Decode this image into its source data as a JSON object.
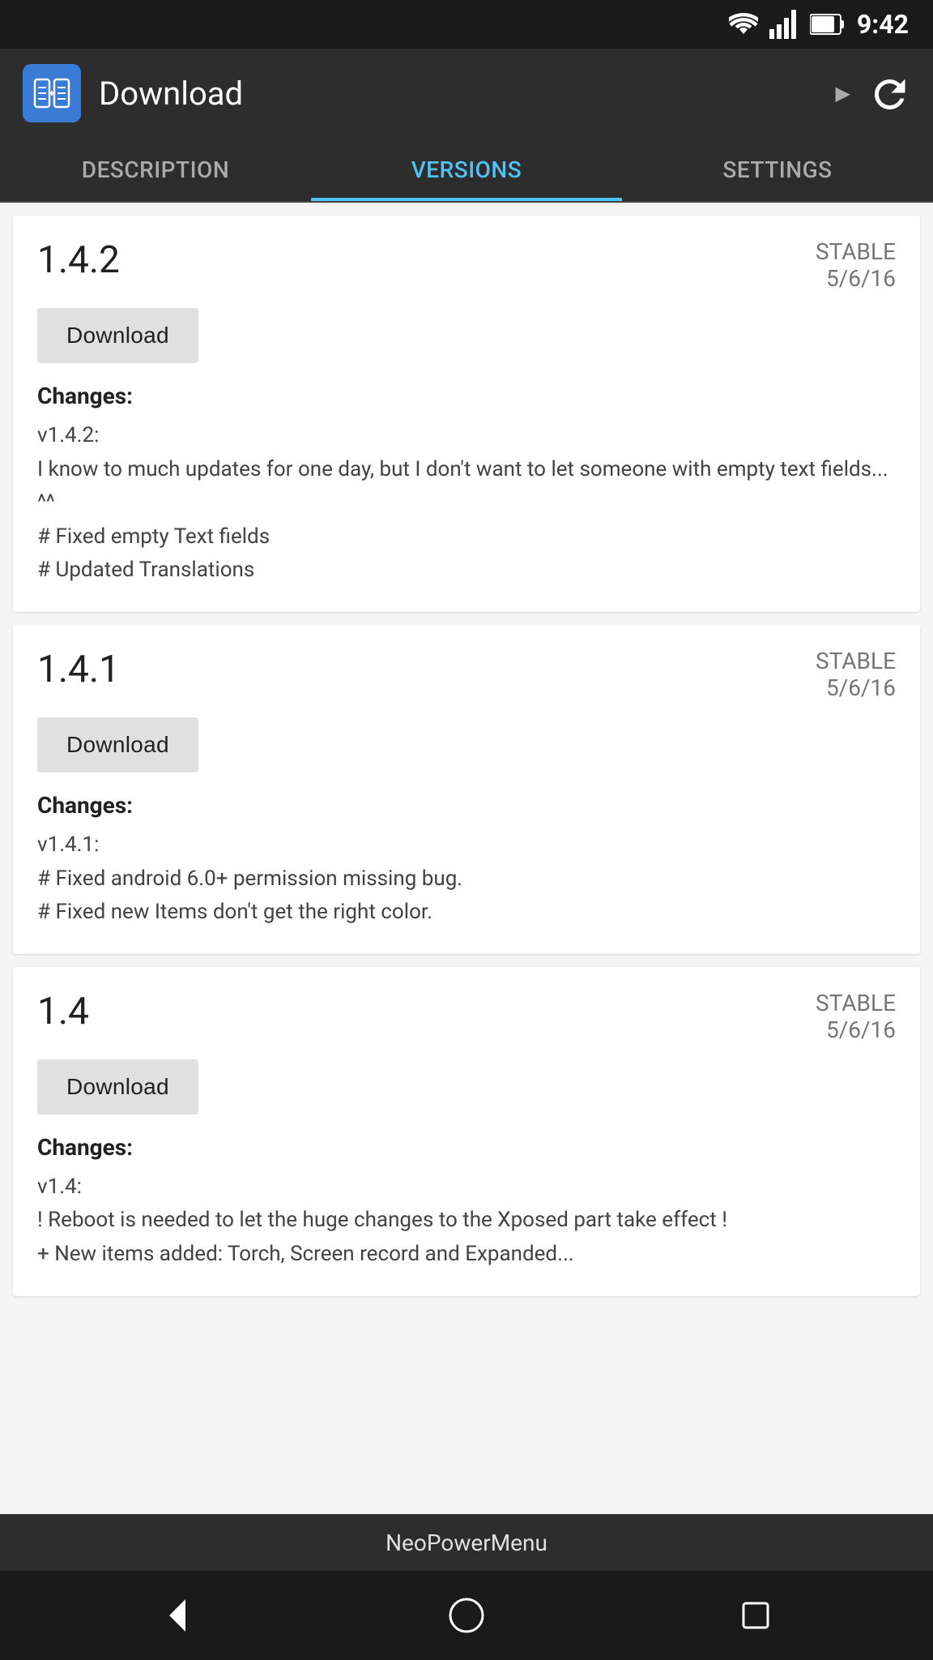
{
  "statusBar": {
    "time": "9:42",
    "batteryIcon": "battery-icon",
    "signalIcon": "signal-icon",
    "wifiIcon": "wifi-icon"
  },
  "toolbar": {
    "title": "Download",
    "refreshIcon": "refresh-icon",
    "appIcon": "app-icon"
  },
  "tabs": [
    {
      "label": "Description",
      "active": false
    },
    {
      "label": "Versions",
      "active": true
    },
    {
      "label": "Settings",
      "active": false
    }
  ],
  "versions": [
    {
      "number": "1.4.2",
      "stable": "STABLE",
      "date": "5/6/16",
      "downloadLabel": "Download",
      "changesLabel": "Changes:",
      "changesText": "v1.4.2:\nI know to much updates for one day, but I don't want to let someone with empty text fields... ^^\n# Fixed empty Text fields\n# Updated Translations"
    },
    {
      "number": "1.4.1",
      "stable": "STABLE",
      "date": "5/6/16",
      "downloadLabel": "Download",
      "changesLabel": "Changes:",
      "changesText": "v1.4.1:\n# Fixed android 6.0+ permission missing bug.\n# Fixed new Items don't get the right color."
    },
    {
      "number": "1.4",
      "stable": "STABLE",
      "date": "5/6/16",
      "downloadLabel": "Download",
      "changesLabel": "Changes:",
      "changesText": "v1.4:\n! Reboot is needed to let the huge changes to the Xposed part take effect !\n+ New items added: Torch, Screen record and Expanded..."
    }
  ],
  "bottomBar": {
    "text": "NeoPowerMenu"
  }
}
